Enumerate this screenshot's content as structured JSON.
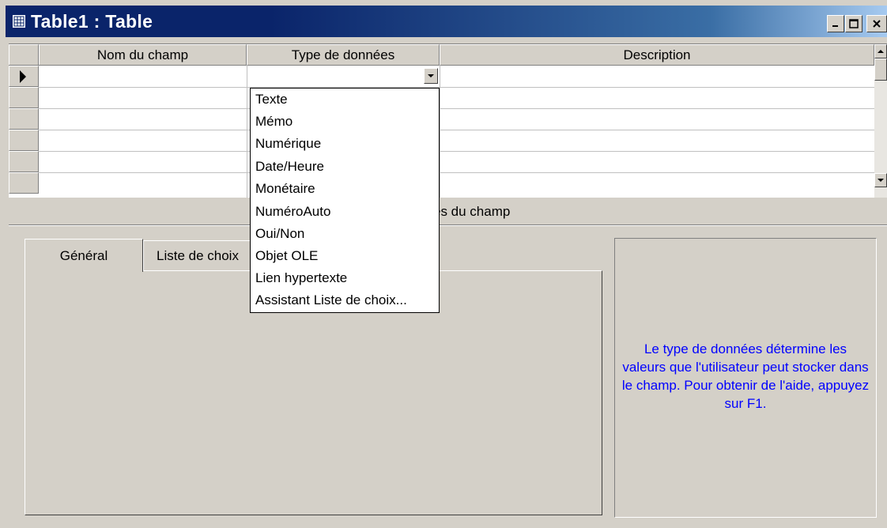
{
  "window": {
    "title": "Table1 : Table",
    "icon": "table-icon",
    "controls": {
      "minimize": "_",
      "maximize": "□",
      "close": "×"
    }
  },
  "grid": {
    "columns": [
      "Nom du champ",
      "Type de données",
      "Description"
    ],
    "row_count": 6,
    "current_row_marker": "▶"
  },
  "dropdown": {
    "options": [
      "Texte",
      "Mémo",
      "Numérique",
      "Date/Heure",
      "Monétaire",
      "NuméroAuto",
      "Oui/Non",
      "Objet OLE",
      "Lien hypertexte",
      "Assistant Liste de choix..."
    ]
  },
  "properties": {
    "label": "és du champ",
    "tabs": [
      "Général",
      "Liste de choix"
    ],
    "help_text": "Le type de données détermine les valeurs que l'utilisateur peut stocker dans le champ. Pour obtenir de l'aide, appuyez sur F1."
  },
  "colors": {
    "titlebar_start": "#0a246a",
    "titlebar_end": "#a6caf0",
    "help_text": "#0000ff",
    "face": "#d4d0c8"
  }
}
